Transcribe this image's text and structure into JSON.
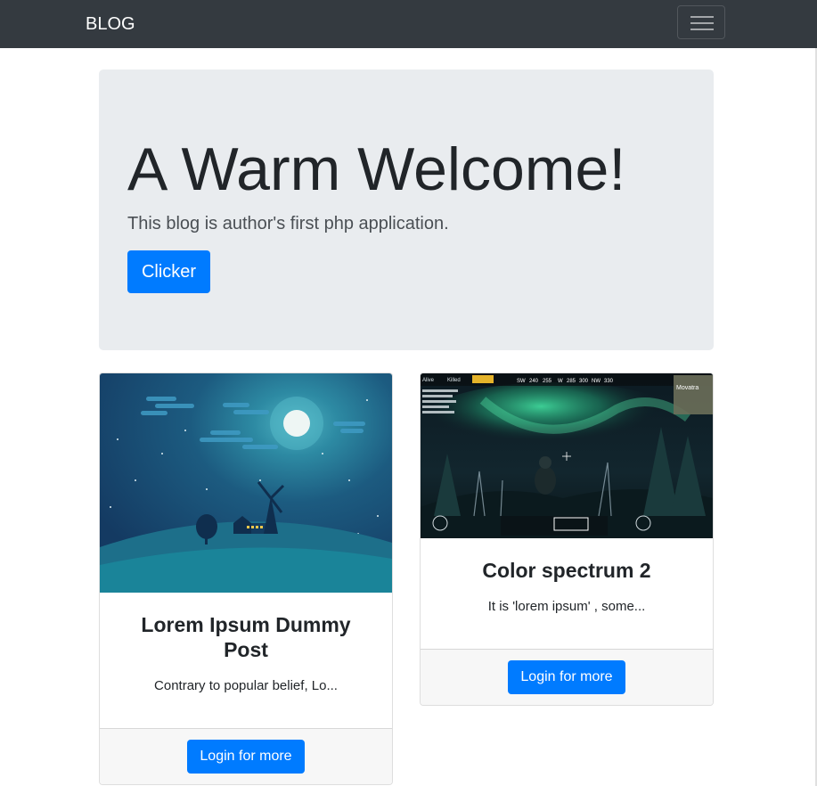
{
  "navbar": {
    "brand": "BLOG",
    "toggler_icon": "hamburger-menu-icon"
  },
  "jumbotron": {
    "title": "A Warm Welcome!",
    "lead": "This blog is author's first php application.",
    "button_label": "Clicker"
  },
  "posts": [
    {
      "title": "Lorem Ipsum Dummy Post",
      "excerpt": "Contrary to popular belief, Lo...",
      "button_label": "Login for more",
      "image": "night-landscape-windmill-moon"
    },
    {
      "title": "Color spectrum 2",
      "excerpt": "It is 'lorem ipsum' , some...",
      "button_label": "Login for more",
      "image": "game-screenshot-aurora-forest"
    }
  ],
  "colors": {
    "navbar_bg": "#343a40",
    "primary": "#007bff",
    "jumbotron_bg": "#e9ecef",
    "card_footer_bg": "#f7f7f7"
  },
  "game_hud": {
    "player": "Alive",
    "killed": "Killed",
    "compass": [
      "SW",
      "240",
      "255",
      "W",
      "285",
      "300",
      "NW",
      "330"
    ],
    "map_label": "Movatra"
  }
}
